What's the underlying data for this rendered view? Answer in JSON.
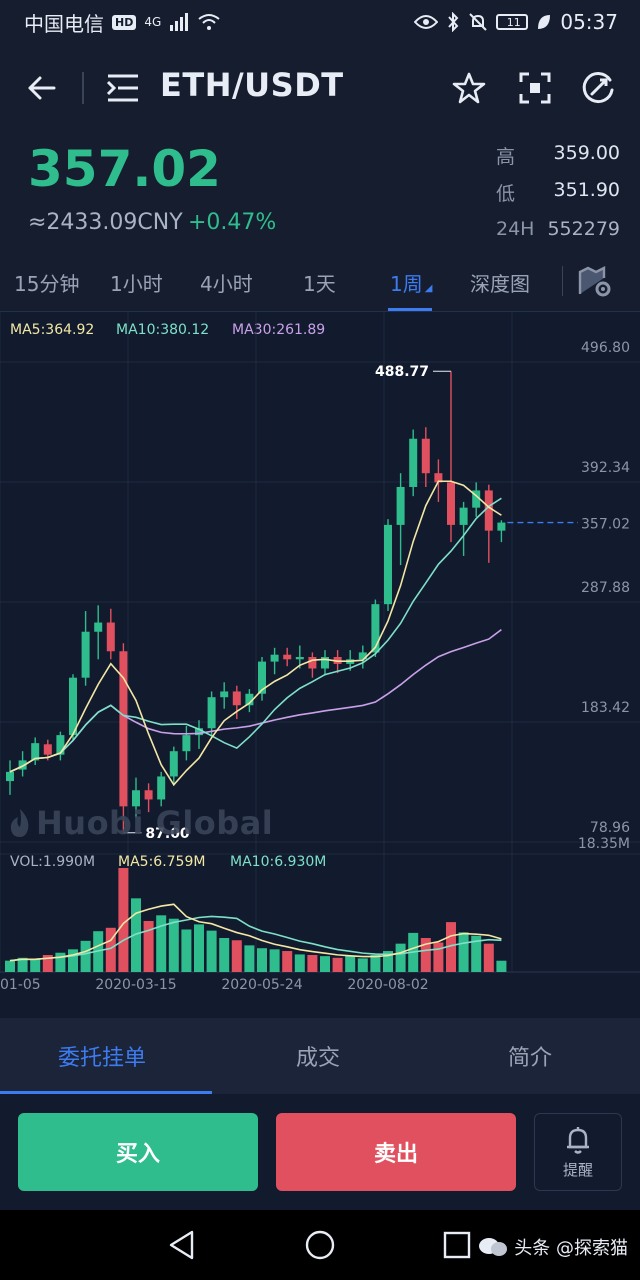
{
  "status_bar": {
    "carrier": "中国电信",
    "hd": "HD",
    "network": "4G",
    "battery": "11",
    "battery_level": 0.11,
    "time": "05:37"
  },
  "header": {
    "pair": "ETH/USDT"
  },
  "ticker": {
    "last_price": "357.02",
    "cny": "≈2433.09CNY",
    "change": "+0.47%",
    "high_label": "高",
    "high": "359.00",
    "low_label": "低",
    "low": "351.90",
    "vol_label": "24H",
    "vol": "552279"
  },
  "intervals": [
    "15分钟",
    "1小时",
    "4小时",
    "1天",
    "1周",
    "深度图"
  ],
  "active_interval": "1周",
  "indicators": {
    "ma5": "MA5:364.92",
    "ma10": "MA10:380.12",
    "ma30": "MA30:261.89",
    "vol": "VOL:1.990M",
    "vol_ma5": "MA5:6.759M",
    "vol_ma10": "MA10:6.930M"
  },
  "watermark": "Huobi Global",
  "colors": {
    "up": "#2fbd8d",
    "down": "#e1505f",
    "accent": "#3d7bf0",
    "ma5": "#f3e7a4",
    "ma10": "#7ee0c8",
    "ma30": "#c9a1e8"
  },
  "chart_data": {
    "type": "candlestick",
    "interval": "1周",
    "y_ticks": [
      "496.80",
      "392.34",
      "287.88",
      "183.42",
      "78.96"
    ],
    "ylim": [
      78.96,
      496.8
    ],
    "vol_max_label": "18.35M",
    "vol_max": 18.35,
    "x_ticks": [
      "01-05",
      "2020-03-15",
      "2020-05-24",
      "2020-08-02"
    ],
    "x_tick_index": [
      0,
      10,
      20,
      30
    ],
    "current_price": "357.02",
    "current_value": 357.02,
    "max_label": "488.77",
    "max_value": 488.77,
    "max_index": 35,
    "min_label": "87.00",
    "min_value": 87.0,
    "min_index": 9,
    "candles": [
      {
        "o": 132,
        "h": 150,
        "l": 120,
        "c": 140
      },
      {
        "o": 142,
        "h": 158,
        "l": 136,
        "c": 150
      },
      {
        "o": 150,
        "h": 170,
        "l": 146,
        "c": 165
      },
      {
        "o": 164,
        "h": 168,
        "l": 150,
        "c": 155
      },
      {
        "o": 155,
        "h": 175,
        "l": 150,
        "c": 172
      },
      {
        "o": 172,
        "h": 225,
        "l": 168,
        "c": 222
      },
      {
        "o": 222,
        "h": 280,
        "l": 215,
        "c": 262
      },
      {
        "o": 262,
        "h": 285,
        "l": 238,
        "c": 270
      },
      {
        "o": 270,
        "h": 282,
        "l": 238,
        "c": 245
      },
      {
        "o": 245,
        "h": 252,
        "l": 87,
        "c": 110
      },
      {
        "o": 110,
        "h": 135,
        "l": 100,
        "c": 124
      },
      {
        "o": 124,
        "h": 130,
        "l": 105,
        "c": 116
      },
      {
        "o": 116,
        "h": 140,
        "l": 110,
        "c": 136
      },
      {
        "o": 136,
        "h": 162,
        "l": 128,
        "c": 158
      },
      {
        "o": 158,
        "h": 180,
        "l": 150,
        "c": 172
      },
      {
        "o": 172,
        "h": 185,
        "l": 160,
        "c": 178
      },
      {
        "o": 178,
        "h": 210,
        "l": 172,
        "c": 205
      },
      {
        "o": 205,
        "h": 218,
        "l": 195,
        "c": 210
      },
      {
        "o": 210,
        "h": 215,
        "l": 186,
        "c": 198
      },
      {
        "o": 198,
        "h": 212,
        "l": 192,
        "c": 208
      },
      {
        "o": 208,
        "h": 240,
        "l": 202,
        "c": 236
      },
      {
        "o": 236,
        "h": 248,
        "l": 225,
        "c": 242
      },
      {
        "o": 242,
        "h": 248,
        "l": 232,
        "c": 238
      },
      {
        "o": 238,
        "h": 250,
        "l": 230,
        "c": 240
      },
      {
        "o": 240,
        "h": 244,
        "l": 222,
        "c": 230
      },
      {
        "o": 230,
        "h": 246,
        "l": 224,
        "c": 240
      },
      {
        "o": 240,
        "h": 246,
        "l": 226,
        "c": 234
      },
      {
        "o": 234,
        "h": 246,
        "l": 228,
        "c": 238
      },
      {
        "o": 238,
        "h": 250,
        "l": 230,
        "c": 244
      },
      {
        "o": 244,
        "h": 290,
        "l": 240,
        "c": 286
      },
      {
        "o": 286,
        "h": 360,
        "l": 280,
        "c": 355
      },
      {
        "o": 355,
        "h": 400,
        "l": 320,
        "c": 388
      },
      {
        "o": 388,
        "h": 438,
        "l": 380,
        "c": 430
      },
      {
        "o": 430,
        "h": 440,
        "l": 388,
        "c": 400
      },
      {
        "o": 400,
        "h": 412,
        "l": 375,
        "c": 392
      },
      {
        "o": 392,
        "h": 488.77,
        "l": 340,
        "c": 355
      },
      {
        "o": 355,
        "h": 375,
        "l": 328,
        "c": 370
      },
      {
        "o": 370,
        "h": 392,
        "l": 362,
        "c": 385
      },
      {
        "o": 385,
        "h": 390,
        "l": 322,
        "c": 350
      },
      {
        "o": 350,
        "h": 359,
        "l": 340,
        "c": 357.02
      }
    ],
    "volumes": [
      2.0,
      2.5,
      2.2,
      3.0,
      3.4,
      4.0,
      5.5,
      7.2,
      7.8,
      18.35,
      13.0,
      9.0,
      10.0,
      9.4,
      7.5,
      8.4,
      7.3,
      6.0,
      5.6,
      4.7,
      4.2,
      4.0,
      3.7,
      3.1,
      3.0,
      2.8,
      2.5,
      2.9,
      2.4,
      3.0,
      3.7,
      5.0,
      6.9,
      6.0,
      5.2,
      8.8,
      7.0,
      6.4,
      5.0,
      1.99
    ]
  },
  "bottom_tabs": [
    "委托挂单",
    "成交",
    "简介"
  ],
  "actions": {
    "buy": "买入",
    "sell": "卖出",
    "alert": "提醒"
  },
  "credit": "头条 @探索猫"
}
